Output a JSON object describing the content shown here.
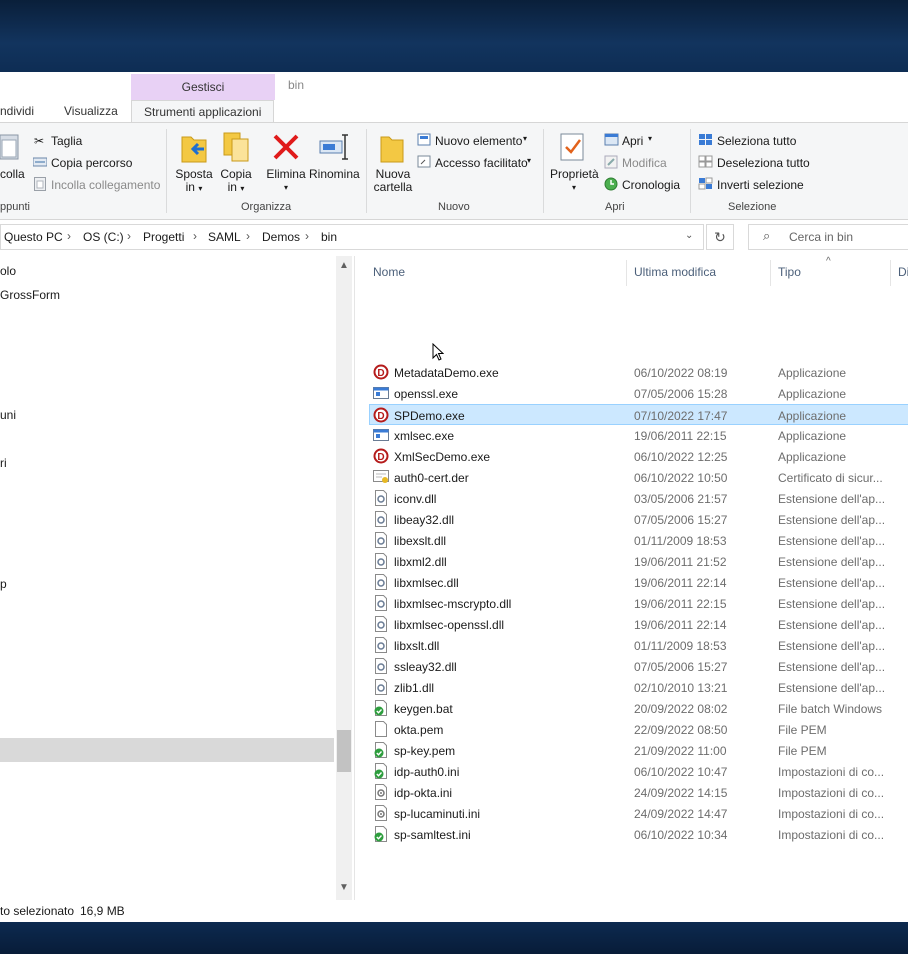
{
  "title": {
    "context_header": "Gestisci",
    "folder": "bin"
  },
  "tabs": [
    "ndividi",
    "Visualizza",
    "Strumenti applicazioni"
  ],
  "ribbon": {
    "clipboard": {
      "incolla": "colla",
      "taglia": "Taglia",
      "copia_percorso": "Copia percorso",
      "incolla_collegamento": "Incolla collegamento",
      "group": "ppunti"
    },
    "organizza": {
      "sposta": "Sposta",
      "sposta2": "in",
      "copia": "Copia",
      "copia2": "in",
      "elimina": "Elimina",
      "rinomina": "Rinomina",
      "group": "Organizza"
    },
    "nuovo": {
      "nuova": "Nuova",
      "cartella": "cartella",
      "nuovo_elemento": "Nuovo elemento",
      "accesso": "Accesso facilitato",
      "group": "Nuovo"
    },
    "apri": {
      "proprieta": "Proprietà",
      "apri": "Apri",
      "modifica": "Modifica",
      "cronologia": "Cronologia",
      "group": "Apri"
    },
    "seleziona": {
      "tutto": "Seleziona tutto",
      "deseleziona": "Deseleziona tutto",
      "inverti": "Inverti selezione",
      "group": "Selezione"
    }
  },
  "address": {
    "crumbs": [
      "Questo PC",
      "OS (C:)",
      "Progetti",
      "SAML",
      "Demos",
      "bin"
    ],
    "search_placeholder": "Cerca in bin"
  },
  "nav": {
    "items": [
      "olo",
      "GrossForm",
      "uni",
      "ri",
      "p"
    ]
  },
  "columns": {
    "name": "Nome",
    "modified": "Ultima modifica",
    "type": "Tipo",
    "size": "Di"
  },
  "files": [
    {
      "name": "MetadataDemo.exe",
      "date": "06/10/2022 08:19",
      "type": "Applicazione",
      "icon": "app-d-icon"
    },
    {
      "name": "openssl.exe",
      "date": "07/05/2006 15:28",
      "type": "Applicazione",
      "icon": "window-exe-icon"
    },
    {
      "name": "SPDemo.exe",
      "date": "07/10/2022 17:47",
      "type": "Applicazione",
      "icon": "app-d-icon"
    },
    {
      "name": "xmlsec.exe",
      "date": "19/06/2011 22:15",
      "type": "Applicazione",
      "icon": "window-exe-icon"
    },
    {
      "name": "XmlSecDemo.exe",
      "date": "06/10/2022 12:25",
      "type": "Applicazione",
      "icon": "app-d-icon"
    },
    {
      "name": "auth0-cert.der",
      "date": "06/10/2022 10:50",
      "type": "Certificato di sicur...",
      "icon": "certificate-icon"
    },
    {
      "name": "iconv.dll",
      "date": "03/05/2006 21:57",
      "type": "Estensione dell'ap...",
      "icon": "dll-icon"
    },
    {
      "name": "libeay32.dll",
      "date": "07/05/2006 15:27",
      "type": "Estensione dell'ap...",
      "icon": "dll-icon"
    },
    {
      "name": "libexslt.dll",
      "date": "01/11/2009 18:53",
      "type": "Estensione dell'ap...",
      "icon": "dll-icon"
    },
    {
      "name": "libxml2.dll",
      "date": "19/06/2011 21:52",
      "type": "Estensione dell'ap...",
      "icon": "dll-icon"
    },
    {
      "name": "libxmlsec.dll",
      "date": "19/06/2011 22:14",
      "type": "Estensione dell'ap...",
      "icon": "dll-icon"
    },
    {
      "name": "libxmlsec-mscrypto.dll",
      "date": "19/06/2011 22:15",
      "type": "Estensione dell'ap...",
      "icon": "dll-icon"
    },
    {
      "name": "libxmlsec-openssl.dll",
      "date": "19/06/2011 22:14",
      "type": "Estensione dell'ap...",
      "icon": "dll-icon"
    },
    {
      "name": "libxslt.dll",
      "date": "01/11/2009 18:53",
      "type": "Estensione dell'ap...",
      "icon": "dll-icon"
    },
    {
      "name": "ssleay32.dll",
      "date": "07/05/2006 15:27",
      "type": "Estensione dell'ap...",
      "icon": "dll-icon"
    },
    {
      "name": "zlib1.dll",
      "date": "02/10/2010 13:21",
      "type": "Estensione dell'ap...",
      "icon": "dll-icon"
    },
    {
      "name": "keygen.bat",
      "date": "20/09/2022 08:02",
      "type": "File batch Windows",
      "icon": "green-check-icon"
    },
    {
      "name": "okta.pem",
      "date": "22/09/2022 08:50",
      "type": "File PEM",
      "icon": "blank-file-icon"
    },
    {
      "name": "sp-key.pem",
      "date": "21/09/2022 11:00",
      "type": "File PEM",
      "icon": "green-check-icon"
    },
    {
      "name": "idp-auth0.ini",
      "date": "06/10/2022 10:47",
      "type": "Impostazioni di co...",
      "icon": "green-check-icon"
    },
    {
      "name": "idp-okta.ini",
      "date": "24/09/2022 14:15",
      "type": "Impostazioni di co...",
      "icon": "ini-icon"
    },
    {
      "name": "sp-lucaminuti.ini",
      "date": "24/09/2022 14:47",
      "type": "Impostazioni di co...",
      "icon": "ini-icon"
    },
    {
      "name": "sp-samltest.ini",
      "date": "06/10/2022 10:34",
      "type": "Impostazioni di co...",
      "icon": "green-check-icon"
    }
  ],
  "status": {
    "selected": "to selezionato",
    "size": "16,9 MB"
  },
  "colors": {
    "accent": "#0078d7",
    "selection": "#cce8ff",
    "context_tab": "#e8d1f5"
  }
}
